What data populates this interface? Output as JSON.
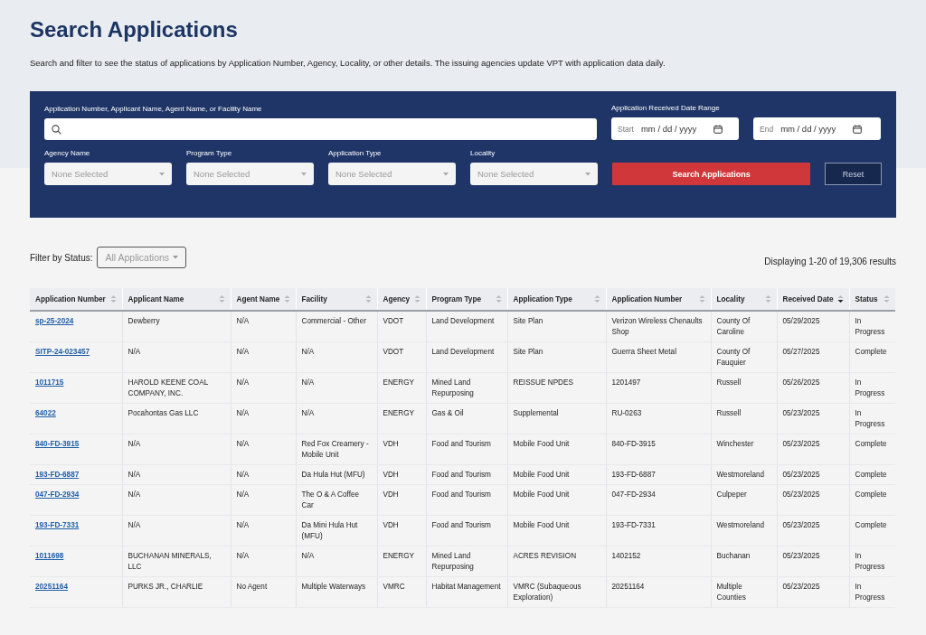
{
  "page": {
    "title": "Search Applications",
    "description": "Search and filter to see the status of applications by Application Number, Agency, Locality, or other details. The issuing agencies update VPT with application data daily."
  },
  "search_panel": {
    "keyword_label": "Application Number, Applicant Name, Agent Name, or Facility Name",
    "date_range": {
      "label": "Application Received Date Range",
      "start": {
        "label": "Start",
        "placeholder": "mm / dd / yyyy"
      },
      "end": {
        "label": "End",
        "placeholder": "mm / dd / yyyy"
      }
    },
    "filters": [
      {
        "label": "Agency Name",
        "placeholder": "None Selected"
      },
      {
        "label": "Program Type",
        "placeholder": "None Selected"
      },
      {
        "label": "Application Type",
        "placeholder": "None Selected"
      },
      {
        "label": "Locality",
        "placeholder": "None Selected"
      }
    ],
    "search_button": "Search Applications",
    "reset_button": "Reset"
  },
  "status_filter": {
    "label": "Filter by Status:",
    "value": "All Applications"
  },
  "results_summary": "Displaying 1-20 of 19,306 results",
  "table": {
    "columns": [
      {
        "label": "Application Number",
        "sorted": false
      },
      {
        "label": "Applicant Name",
        "sorted": false
      },
      {
        "label": "Agent Name",
        "sorted": false
      },
      {
        "label": "Facility",
        "sorted": false
      },
      {
        "label": "Agency",
        "sorted": false
      },
      {
        "label": "Program Type",
        "sorted": false
      },
      {
        "label": "Application Type",
        "sorted": false
      },
      {
        "label": "Application Number",
        "sorted": false
      },
      {
        "label": "Locality",
        "sorted": false
      },
      {
        "label": "Received Date",
        "sorted": true
      },
      {
        "label": "Status",
        "sorted": false
      }
    ],
    "rows": [
      [
        "sp-25-2024",
        "Dewberry",
        "N/A",
        "Commercial - Other",
        "VDOT",
        "Land Development",
        "Site Plan",
        "Verizon Wireless Chenaults Shop",
        "County Of Caroline",
        "05/29/2025",
        "In Progress"
      ],
      [
        "SITP-24-023457",
        "N/A",
        "N/A",
        "N/A",
        "VDOT",
        "Land Development",
        "Site Plan",
        "Guerra Sheet Metal",
        "County Of Fauquier",
        "05/27/2025",
        "Complete"
      ],
      [
        "1011715",
        "HAROLD KEENE COAL COMPANY, INC.",
        "N/A",
        "N/A",
        "ENERGY",
        "Mined Land Repurposing",
        "REISSUE NPDES",
        "1201497",
        "Russell",
        "05/26/2025",
        "In Progress"
      ],
      [
        "64022",
        "Pocahontas Gas LLC",
        "N/A",
        "N/A",
        "ENERGY",
        "Gas & Oil",
        "Supplemental",
        "RU-0263",
        "Russell",
        "05/23/2025",
        "In Progress"
      ],
      [
        "840-FD-3915",
        "N/A",
        "N/A",
        "Red Fox Creamery - Mobile Unit",
        "VDH",
        "Food and Tourism",
        "Mobile Food Unit",
        "840-FD-3915",
        "Winchester",
        "05/23/2025",
        "Complete"
      ],
      [
        "193-FD-6887",
        "N/A",
        "N/A",
        "Da Hula Hut (MFU)",
        "VDH",
        "Food and Tourism",
        "Mobile Food Unit",
        "193-FD-6887",
        "Westmoreland",
        "05/23/2025",
        "Complete"
      ],
      [
        "047-FD-2934",
        "N/A",
        "N/A",
        "The O & A Coffee Car",
        "VDH",
        "Food and Tourism",
        "Mobile Food Unit",
        "047-FD-2934",
        "Culpeper",
        "05/23/2025",
        "Complete"
      ],
      [
        "193-FD-7331",
        "N/A",
        "N/A",
        "Da Mini Hula Hut (MFU)",
        "VDH",
        "Food and Tourism",
        "Mobile Food Unit",
        "193-FD-7331",
        "Westmoreland",
        "05/23/2025",
        "Complete"
      ],
      [
        "1011698",
        "BUCHANAN MINERALS, LLC",
        "N/A",
        "N/A",
        "ENERGY",
        "Mined Land Repurposing",
        "ACRES REVISION",
        "1402152",
        "Buchanan",
        "05/23/2025",
        "In Progress"
      ],
      [
        "20251164",
        "PURKS JR., CHARLIE",
        "No Agent",
        "Multiple Waterways",
        "VMRC",
        "Habitat Management",
        "VMRC (Subaqueous Exploration)",
        "20251164",
        "Multiple Counties",
        "05/23/2025",
        "In Progress"
      ]
    ]
  }
}
